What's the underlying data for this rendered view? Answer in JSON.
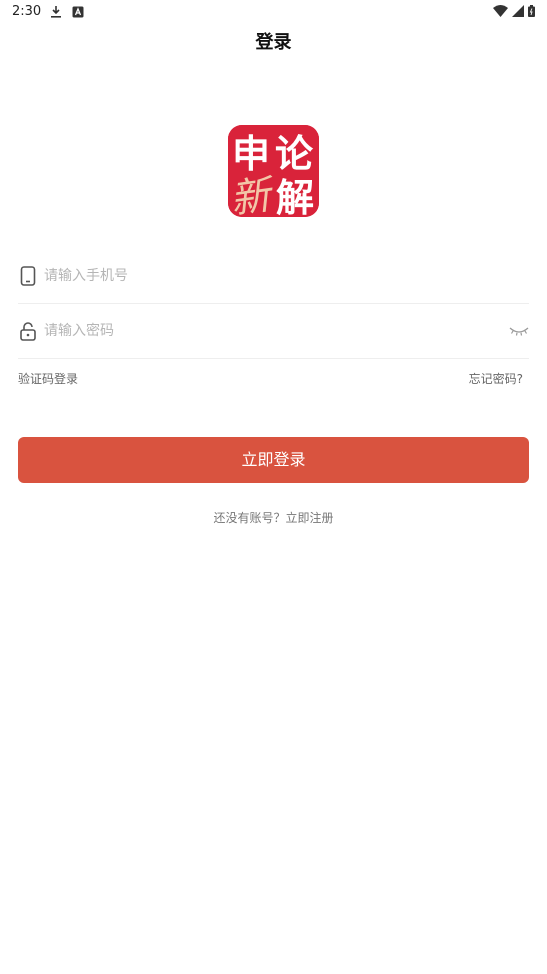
{
  "status_bar": {
    "time": "2:30",
    "left_icons": [
      "download-icon",
      "app-notification-icon"
    ],
    "right_icons": [
      "wifi-icon",
      "signal-icon",
      "battery-icon"
    ]
  },
  "page": {
    "title": "登录"
  },
  "logo": {
    "chars": [
      "申",
      "论",
      "新",
      "解"
    ],
    "bg_color": "#d9233a"
  },
  "form": {
    "phone_placeholder": "请输入手机号",
    "password_placeholder": "请输入密码",
    "sms_login_label": "验证码登录",
    "forgot_password_label": "忘记密码?"
  },
  "actions": {
    "login_label": "立即登录",
    "login_color": "#d9533f",
    "register_text": "还没有账号？立即注册"
  }
}
